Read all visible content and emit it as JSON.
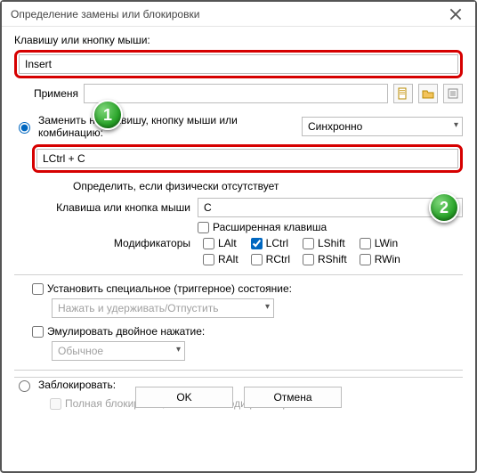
{
  "window": {
    "title": "Определение замены или блокировки"
  },
  "labels": {
    "keyOrMouse": "Клавишу или кнопку мыши:",
    "applyTo": "Применя",
    "defineIfAbsent": "Определить, если физически отсутствует",
    "keyOrMouse2": "Клавиша или кнопка мыши",
    "extendedKey": "Расширенная клавиша",
    "modifiers": "Модификаторы"
  },
  "fields": {
    "insert": "Insert",
    "combo": "LCtrl + C",
    "keyC": "C",
    "syncMode": "Синхронно"
  },
  "radios": {
    "replace": "Заменить на клавишу, кнопку мыши или комбинацию:",
    "block": "Заблокировать:"
  },
  "mods": {
    "lalt": "LAlt",
    "lctrl": "LCtrl",
    "lshift": "LShift",
    "lwin": "LWin",
    "ralt": "RAlt",
    "rctrl": "RCtrl",
    "rshift": "RShift",
    "rwin": "RWin"
  },
  "checkboxes": {
    "trigger": "Установить специальное (триггерное) состояние:",
    "triggerMode": "Нажать и удерживать/Отпустить",
    "double": "Эмулировать двойное нажатие:",
    "doubleMode": "Обычное",
    "fullBlock": "Полная блокировка, включая с модификаторами"
  },
  "buttons": {
    "ok": "OK",
    "cancel": "Отмена"
  },
  "markers": {
    "m1": "1",
    "m2": "2"
  }
}
